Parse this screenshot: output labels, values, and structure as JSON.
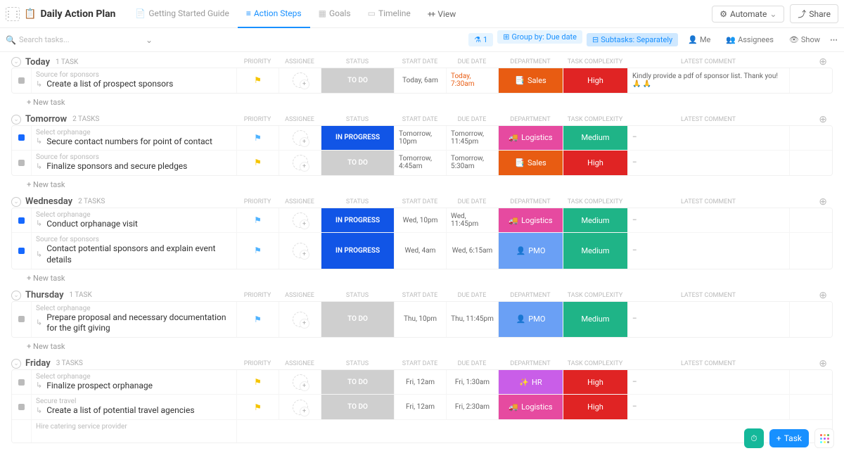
{
  "header": {
    "title": "Daily Action Plan",
    "tabs": [
      {
        "label": "Getting Started Guide"
      },
      {
        "label": "Action Steps"
      },
      {
        "label": "Goals"
      },
      {
        "label": "Timeline"
      }
    ],
    "addView": "+ View",
    "automate": "Automate",
    "share": "Share"
  },
  "filter": {
    "searchPlaceholder": "Search tasks...",
    "filterCount": "1",
    "groupBy": "Group by: Due date",
    "subtasks": "Subtasks: Separately",
    "me": "Me",
    "assignees": "Assignees",
    "show": "Show"
  },
  "columns": {
    "priority": "PRIORITY",
    "assignee": "ASSIGNEE",
    "status": "STATUS",
    "start": "START DATE",
    "due": "DUE DATE",
    "dept": "DEPARTMENT",
    "complex": "TASK COMPLEXITY",
    "comment": "LATEST COMMENT"
  },
  "newTaskLabel": "+ New task",
  "groups": [
    {
      "name": "Today",
      "count": "1 TASK",
      "tasks": [
        {
          "parent": "Source for sponsors",
          "title": "Create a list of prospect sponsors",
          "sq": "grey",
          "flag": "yellow",
          "status": "TO DO",
          "statusCls": "todo",
          "start": "Today, 6am",
          "due": "Today, 7:30am",
          "dueCls": "overdue",
          "dept": "Sales",
          "deptCls": "sales",
          "deptIcon": "📑",
          "complex": "High",
          "complexCls": "high",
          "comment": "Kindly provide a pdf of sponsor list. Thank you! 🙏 🙏"
        }
      ]
    },
    {
      "name": "Tomorrow",
      "count": "2 TASKS",
      "tasks": [
        {
          "parent": "Select orphanage",
          "title": "Secure contact numbers for point of contact",
          "sq": "blue",
          "flag": "blue",
          "status": "IN PROGRESS",
          "statusCls": "prog",
          "start": "Tomorrow, 10pm",
          "due": "Tomorrow, 11:45pm",
          "dept": "Logistics",
          "deptCls": "log",
          "deptIcon": "🚚",
          "complex": "Medium",
          "complexCls": "med",
          "comment": "–"
        },
        {
          "parent": "Source for sponsors",
          "title": "Finalize sponsors and secure pledges",
          "sq": "grey",
          "flag": "yellow",
          "status": "TO DO",
          "statusCls": "todo",
          "start": "Tomorrow, 4:45am",
          "due": "Tomorrow, 5:30am",
          "dept": "Sales",
          "deptCls": "sales",
          "deptIcon": "📑",
          "complex": "High",
          "complexCls": "high",
          "comment": "–"
        }
      ]
    },
    {
      "name": "Wednesday",
      "count": "2 TASKS",
      "tasks": [
        {
          "parent": "Select orphanage",
          "title": "Conduct orphanage visit",
          "sq": "blue",
          "flag": "blue",
          "status": "IN PROGRESS",
          "statusCls": "prog",
          "start": "Wed, 10pm",
          "due": "Wed, 11:45pm",
          "dept": "Logistics",
          "deptCls": "log",
          "deptIcon": "🚚",
          "complex": "Medium",
          "complexCls": "med",
          "comment": "–"
        },
        {
          "parent": "Source for sponsors",
          "title": "Contact potential sponsors and explain event details",
          "sq": "blue",
          "flag": "blue",
          "status": "IN PROGRESS",
          "statusCls": "prog",
          "start": "Wed, 4am",
          "due": "Wed, 6:15am",
          "dept": "PMO",
          "deptCls": "pmo",
          "deptIcon": "👤",
          "complex": "Medium",
          "complexCls": "med",
          "comment": "–"
        }
      ]
    },
    {
      "name": "Thursday",
      "count": "1 TASK",
      "tasks": [
        {
          "parent": "Select orphanage",
          "title": "Prepare proposal and necessary documentation for the gift giving",
          "sq": "grey",
          "flag": "blue",
          "status": "TO DO",
          "statusCls": "todo",
          "start": "Thu, 10pm",
          "due": "Thu, 11:45pm",
          "dept": "PMO",
          "deptCls": "pmo",
          "deptIcon": "👤",
          "complex": "Medium",
          "complexCls": "med",
          "comment": "–"
        }
      ]
    },
    {
      "name": "Friday",
      "count": "3 TASKS",
      "tasks": [
        {
          "parent": "Select orphanage",
          "title": "Finalize prospect orphanage",
          "sq": "grey",
          "flag": "yellow",
          "status": "TO DO",
          "statusCls": "todo",
          "start": "Fri, 12am",
          "due": "Fri, 1:30am",
          "dept": "HR",
          "deptCls": "hr",
          "deptIcon": "✨",
          "complex": "High",
          "complexCls": "high",
          "comment": "–"
        },
        {
          "parent": "Secure travel",
          "title": "Create a list of potential travel agencies",
          "sq": "grey",
          "flag": "yellow",
          "status": "TO DO",
          "statusCls": "todo",
          "start": "Fri, 12am",
          "due": "Fri, 2:30am",
          "dept": "Logistics",
          "deptCls": "log",
          "deptIcon": "🚚",
          "complex": "High",
          "complexCls": "high",
          "comment": "–"
        },
        {
          "parent": "Hire catering service provider",
          "title": "",
          "sq": "",
          "flag": "",
          "status": "",
          "statusCls": "",
          "start": "",
          "due": "",
          "dept": "",
          "deptCls": "",
          "complex": "",
          "complexCls": "",
          "comment": ""
        }
      ]
    }
  ],
  "fab": {
    "task": "Task"
  }
}
